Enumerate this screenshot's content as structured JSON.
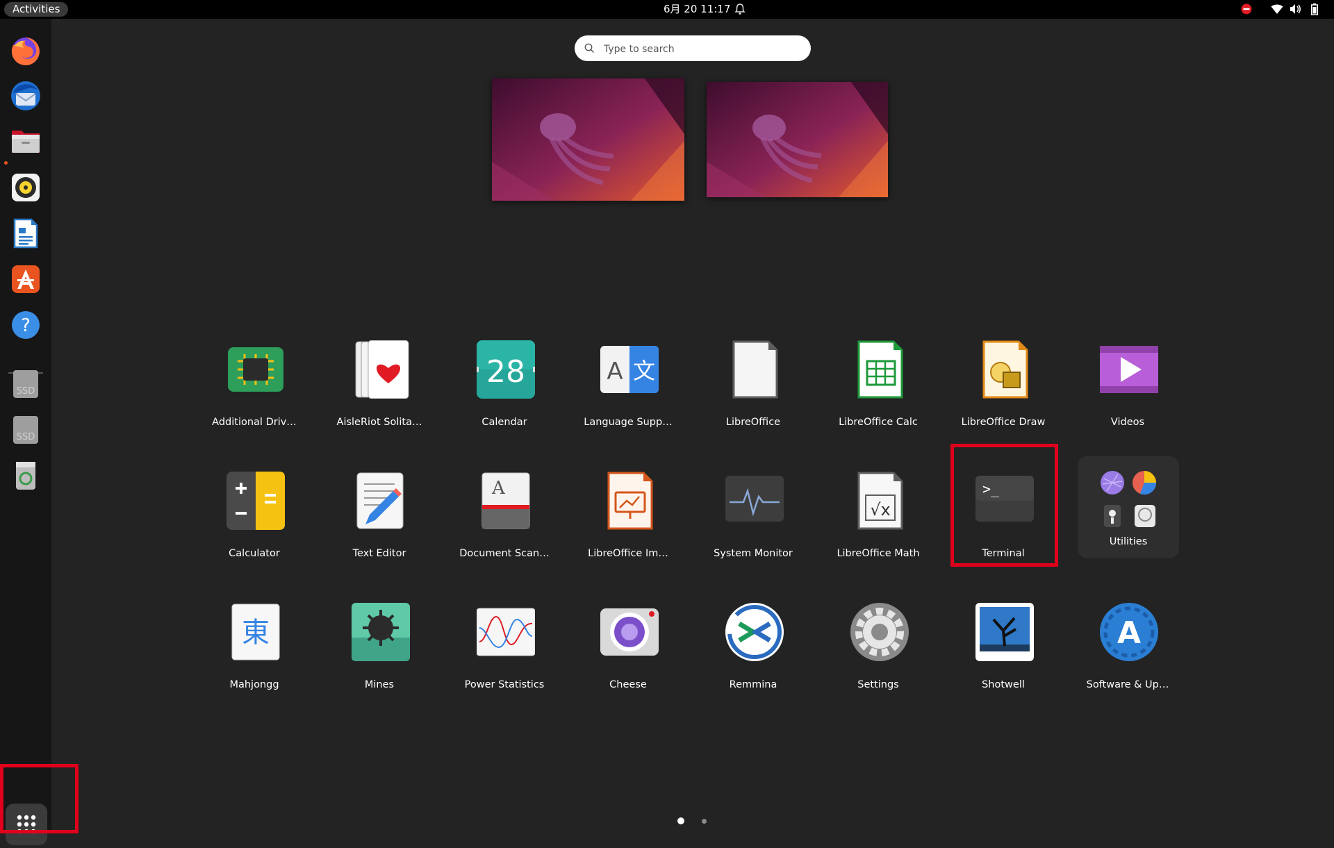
{
  "topbar": {
    "activities_label": "Activities",
    "clock": "6月 20  11:17"
  },
  "search": {
    "placeholder": "Type to search"
  },
  "dock": {
    "items": [
      "firefox-icon",
      "thunderbird-icon",
      "files-icon",
      "rhythmbox-icon",
      "libreoffice-writer-icon",
      "app-center-icon",
      "help-icon",
      "ssd-drive-icon",
      "ssd-drive-icon",
      "trash-icon"
    ],
    "ssd_label": "SSD"
  },
  "apps": {
    "row1": [
      {
        "label": "Additional Driv…"
      },
      {
        "label": "AisleRiot Solita…"
      },
      {
        "label": "Calendar",
        "day": "28"
      },
      {
        "label": "Language Supp…",
        "glyph_a": "A",
        "glyph_b": "文"
      },
      {
        "label": "LibreOffice"
      },
      {
        "label": "LibreOffice Calc"
      },
      {
        "label": "LibreOffice Draw"
      },
      {
        "label": "Videos"
      }
    ],
    "row2": [
      {
        "label": "Calculator"
      },
      {
        "label": "Text Editor"
      },
      {
        "label": "Document Scan…",
        "glyph": "A"
      },
      {
        "label": "LibreOffice Im…"
      },
      {
        "label": "System Monitor"
      },
      {
        "label": "LibreOffice Math",
        "glyph": "√x"
      },
      {
        "label": "Terminal",
        "glyph": ">_"
      },
      {
        "label": "Utilities"
      }
    ],
    "row3": [
      {
        "label": "Mahjongg",
        "glyph": "東"
      },
      {
        "label": "Mines"
      },
      {
        "label": "Power Statistics"
      },
      {
        "label": "Cheese"
      },
      {
        "label": "Remmina"
      },
      {
        "label": "Settings"
      },
      {
        "label": "Shotwell"
      },
      {
        "label": "Software & Up…",
        "glyph": "A"
      }
    ]
  },
  "pagination": {
    "pages": 2,
    "current": 1
  },
  "colors": {
    "highlight": "#e0001b",
    "accent": "#e95420"
  }
}
